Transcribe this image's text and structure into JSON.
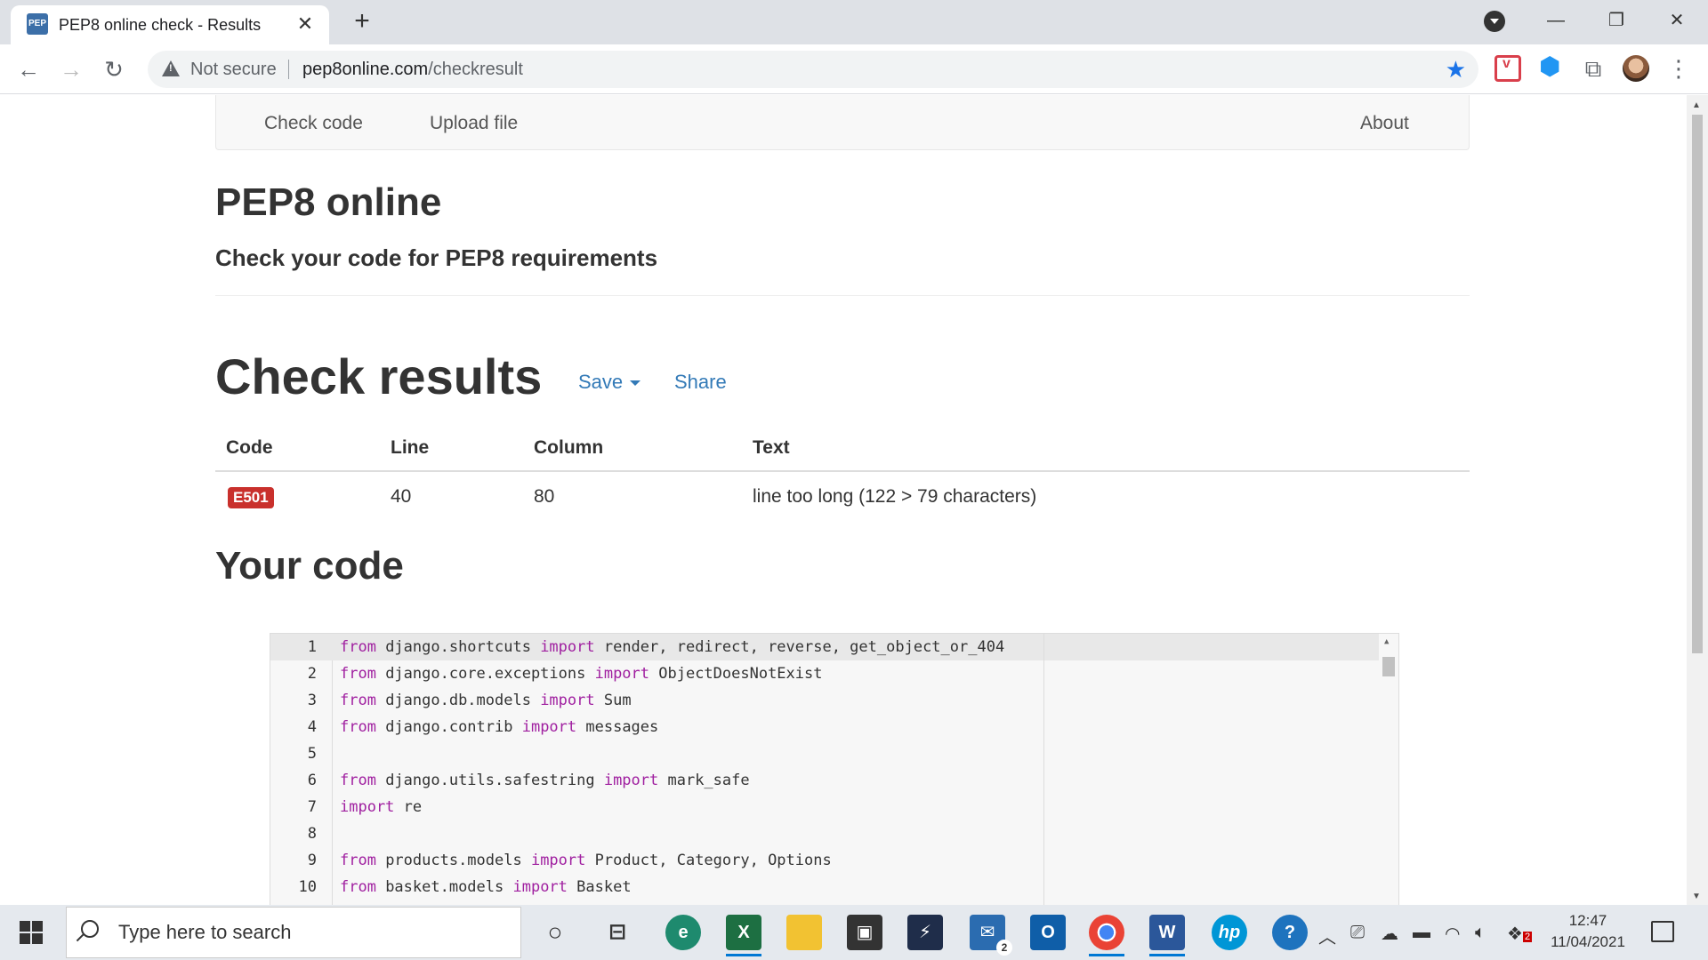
{
  "browser": {
    "tab_title": "PEP8 online check - Results",
    "favicon_text": "PEP 8",
    "close_glyph": "✕",
    "newtab_glyph": "+",
    "not_secure": "Not secure",
    "url_host": "pep8online.com",
    "url_path": "/checkresult"
  },
  "nav": {
    "check_code": "Check code",
    "upload_file": "Upload file",
    "about": "About"
  },
  "header": {
    "title": "PEP8 online",
    "subtitle": "Check your code for PEP8 requirements"
  },
  "results": {
    "title": "Check results",
    "save": "Save",
    "share": "Share",
    "columns": [
      "Code",
      "Line",
      "Column",
      "Text"
    ],
    "rows": [
      {
        "code": "E501",
        "line": "40",
        "column": "80",
        "text": "line too long (122 > 79 characters)"
      }
    ]
  },
  "code_section": {
    "title": "Your code",
    "lines": [
      {
        "n": "1",
        "kw1": "from",
        "mid": " django.shortcuts ",
        "kw2": "import",
        "rest": " render, redirect, reverse, get_object_or_404"
      },
      {
        "n": "2",
        "kw1": "from",
        "mid": " django.core.exceptions ",
        "kw2": "import",
        "rest": " ObjectDoesNotExist"
      },
      {
        "n": "3",
        "kw1": "from",
        "mid": " django.db.models ",
        "kw2": "import",
        "rest": " Sum"
      },
      {
        "n": "4",
        "kw1": "from",
        "mid": " django.contrib ",
        "kw2": "import",
        "rest": " messages"
      },
      {
        "n": "5",
        "kw1": "",
        "mid": "",
        "kw2": "",
        "rest": ""
      },
      {
        "n": "6",
        "kw1": "from",
        "mid": " django.utils.safestring ",
        "kw2": "import",
        "rest": " mark_safe"
      },
      {
        "n": "7",
        "kw1": "import",
        "mid": " re",
        "kw2": "",
        "rest": ""
      },
      {
        "n": "8",
        "kw1": "",
        "mid": "",
        "kw2": "",
        "rest": ""
      },
      {
        "n": "9",
        "kw1": "from",
        "mid": " products.models ",
        "kw2": "import",
        "rest": " Product, Category, Options"
      },
      {
        "n": "10",
        "kw1": "from",
        "mid": " basket.models ",
        "kw2": "import",
        "rest": " Basket"
      }
    ]
  },
  "taskbar": {
    "search_placeholder": "Type here to search",
    "time": "12:47",
    "date": "11/04/2021",
    "mail_count": "2",
    "dropbox_count": "2"
  }
}
